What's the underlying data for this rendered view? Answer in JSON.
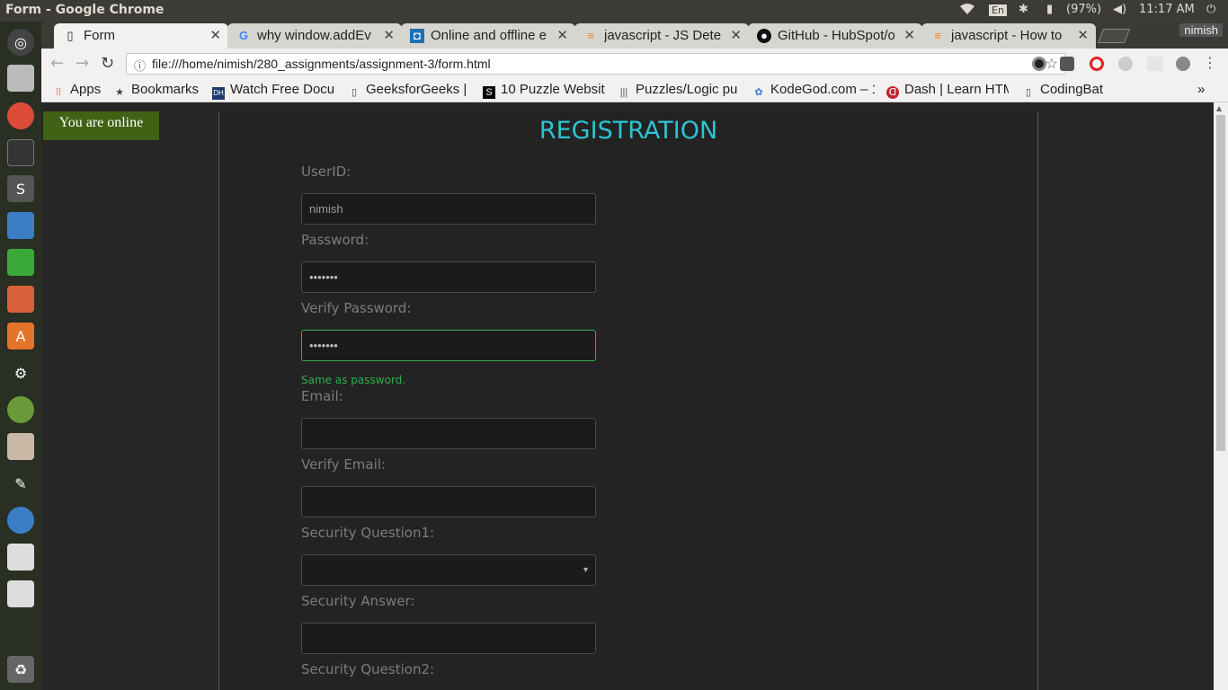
{
  "window": {
    "title": "Form - Google Chrome"
  },
  "system": {
    "battery": "(97%)",
    "time": "11:17 AM",
    "keyboard": "En",
    "user": "nimish"
  },
  "tabs": [
    {
      "label": "Form",
      "icon": "page-icon"
    },
    {
      "label": "why window.addEv",
      "icon": "google-icon"
    },
    {
      "label": "Online and offline e",
      "icon": "site-icon"
    },
    {
      "label": "javascript - JS Dete",
      "icon": "stackoverflow-icon"
    },
    {
      "label": "GitHub - HubSpot/o",
      "icon": "github-icon"
    },
    {
      "label": "javascript - How to",
      "icon": "stackoverflow-icon"
    }
  ],
  "toolbar": {
    "url": "file:///home/nimish/280_assignments/assignment-3/form.html"
  },
  "bookmarks": [
    {
      "label": "Apps"
    },
    {
      "label": "Bookmarks"
    },
    {
      "label": "Watch Free Docu"
    },
    {
      "label": "GeeksforGeeks |"
    },
    {
      "label": "10 Puzzle Websit"
    },
    {
      "label": "Puzzles/Logic pu"
    },
    {
      "label": "KodeGod.com – 1"
    },
    {
      "label": "Dash | Learn HTM"
    },
    {
      "label": "CodingBat"
    }
  ],
  "page": {
    "status": "You are online",
    "title": "REGISTRATION",
    "fields": {
      "userid_label": "UserID:",
      "userid_value": "nimish",
      "password_label": "Password:",
      "password_value": "•••••••",
      "verify_password_label": "Verify Password:",
      "verify_password_value": "•••••••",
      "verify_password_hint": "Same as password.",
      "email_label": "Email:",
      "verify_email_label": "Verify Email:",
      "sq1_label": "Security Question1:",
      "answer_label": "Security Answer:",
      "sq2_label": "Security Question2:"
    }
  }
}
